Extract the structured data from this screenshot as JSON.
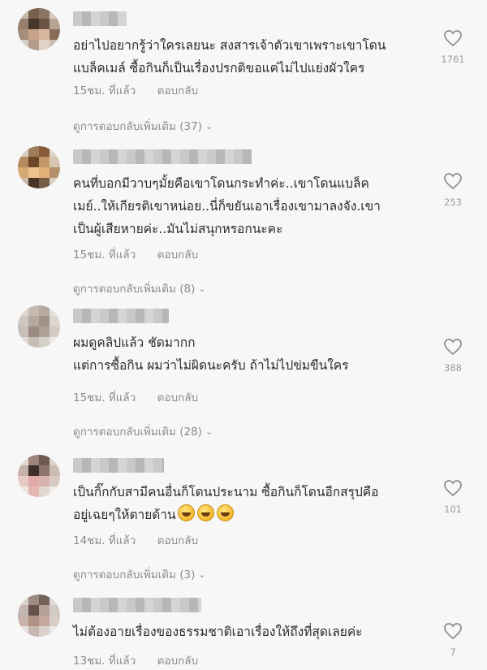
{
  "comments": [
    {
      "text": "อย่าไปอยากรู้ว่าใครเลยนะ สงสารเจ้าตัวเขาเพราะเขาโดน\nแบล็คเมล์ ซื้อกินก็เป็นเรื่องปรกติขอแค่ไม่ไปแย่งผัวใคร",
      "time": "15ชม. ที่แล้ว",
      "reply": "ตอบกลับ",
      "likes": "1761",
      "more_replies": "ดูการตอบกลับเพิ่มเติม (37)"
    },
    {
      "text": "คนที่บอกมีวาบๆมั้ยคือเขาโดนกระทำค่ะ..เขาโดนแบล็ค\nเมย์..ให้เกียรติเขาหน่อย..นี่ก็ขยันเอาเรื่องเขามาลงจัง.เขา\nเป็นผู้เสียหายค่ะ..มันไม่สนุกหรอกนะคะ",
      "time": "15ชม. ที่แล้ว",
      "reply": "ตอบกลับ",
      "likes": "253",
      "more_replies": "ดูการตอบกลับเพิ่มเติม (8)"
    },
    {
      "text": "ผมดูคลิปแล้ว ชัดมากก\nแต่การซื้อกิน ผมว่าไม่ผิดนะครับ ถ้าไม่ไปข่มขืนใคร",
      "time": "15ชม. ที่แล้ว",
      "reply": "ตอบกลับ",
      "likes": "388",
      "more_replies": "ดูการตอบกลับเพิ่มเติม (28)"
    },
    {
      "text": "เป็นกิ๊กกับสามีคนอื่นก็โดนประนาม ซื้อกินก็โดนอีกสรุปคือ\nอยู่เฉยๆให้ตายด้าน",
      "time": "14ชม. ที่แล้ว",
      "reply": "ตอบกลับ",
      "likes": "101",
      "more_replies": "ดูการตอบกลับเพิ่มเติม (3)"
    },
    {
      "text": "ไม่ต้องอายเรื่องของธรรมชาติเอาเรื่องให้ถึงที่สุดเลยค่ะ",
      "time": "13ชม. ที่แล้ว",
      "reply": "ตอบกลับ",
      "likes": "7"
    }
  ],
  "icons": {
    "like": "heart-outline-icon",
    "expand": "chevron-down-icon",
    "emoji": "grinning-face-emoji"
  },
  "colors": {
    "background": "#f7f7f7",
    "text": "#2a2a2a",
    "meta": "#8a8b91"
  }
}
